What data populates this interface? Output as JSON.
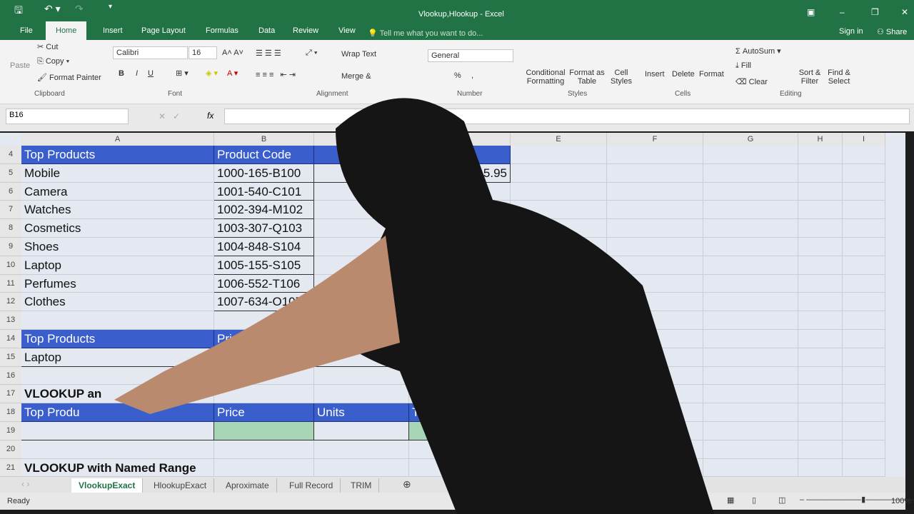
{
  "title": {
    "doc": "Vlookup,Hlookup - Excel",
    "sign_in": "Sign in",
    "share": "Share"
  },
  "tabs": [
    "File",
    "Home",
    "Insert",
    "Page Layout",
    "Formulas",
    "Data",
    "Review",
    "View"
  ],
  "tell_me": "Tell me what you want to do...",
  "ribbon": {
    "clipboard": {
      "paste": "Paste",
      "cut": "Cut",
      "copy": "Copy",
      "format_painter": "Format Painter",
      "label": "Clipboard"
    },
    "font": {
      "name": "Calibri",
      "size": "16",
      "label": "Font",
      "bold": "B",
      "italic": "I",
      "underline": "U"
    },
    "alignment": {
      "wrap": "Wrap Text",
      "merge": "Merge &",
      "label": "Alignment"
    },
    "number": {
      "format": "General",
      "percent": "%",
      "comma": ",",
      "label": "Number"
    },
    "styles": {
      "conditional": "Conditional Formatting",
      "format_table": "Format as Table",
      "cell_styles": "Cell Styles",
      "label": "Styles"
    },
    "cells": {
      "insert": "Insert",
      "delete": "Delete",
      "format": "Format",
      "label": "Cells"
    },
    "editing": {
      "autosum": "AutoSum",
      "fill": "Fill",
      "clear": "Clear",
      "sort": "Sort & Filter",
      "find": "Find & Select",
      "label": "Editing"
    }
  },
  "formula_bar": {
    "name_box": "B16",
    "fx": "fx",
    "value": ""
  },
  "columns": [
    "A",
    "B",
    "",
    "",
    "E",
    "F",
    "G",
    "H",
    "I"
  ],
  "rows": [
    {
      "n": "4",
      "cells": [
        {
          "c": 0,
          "t": "Top Products",
          "s": "hdr"
        },
        {
          "c": 1,
          "t": "Product Code",
          "s": "hdr"
        },
        {
          "c": 2,
          "t": "",
          "s": "hdr"
        },
        {
          "c": 3,
          "t": "",
          "s": "hdr"
        }
      ]
    },
    {
      "n": "5",
      "cells": [
        {
          "c": 0,
          "t": "Mobile"
        },
        {
          "c": 1,
          "t": "1000-165-B100",
          "s": "bd"
        },
        {
          "c": 2,
          "t": "",
          "s": "bd"
        },
        {
          "c": 3,
          "t": "5.95",
          "s": "bd r"
        }
      ]
    },
    {
      "n": "6",
      "cells": [
        {
          "c": 0,
          "t": "Camera"
        },
        {
          "c": 1,
          "t": "1001-540-C101",
          "s": "bd"
        }
      ]
    },
    {
      "n": "7",
      "cells": [
        {
          "c": 0,
          "t": "Watches"
        },
        {
          "c": 1,
          "t": "1002-394-M102",
          "s": "bd"
        }
      ]
    },
    {
      "n": "8",
      "cells": [
        {
          "c": 0,
          "t": "Cosmetics"
        },
        {
          "c": 1,
          "t": "1003-307-Q103",
          "s": "bd"
        }
      ]
    },
    {
      "n": "9",
      "cells": [
        {
          "c": 0,
          "t": "Shoes"
        },
        {
          "c": 1,
          "t": "1004-848-S104",
          "s": "bd"
        }
      ]
    },
    {
      "n": "10",
      "cells": [
        {
          "c": 0,
          "t": "Laptop"
        },
        {
          "c": 1,
          "t": "1005-155-S105",
          "s": "bd"
        }
      ]
    },
    {
      "n": "11",
      "cells": [
        {
          "c": 0,
          "t": "Perfumes"
        },
        {
          "c": 1,
          "t": "1006-552-T106",
          "s": "bd"
        }
      ]
    },
    {
      "n": "12",
      "cells": [
        {
          "c": 0,
          "t": "Clothes"
        },
        {
          "c": 1,
          "t": "1007-634-O107",
          "s": "bd"
        }
      ]
    },
    {
      "n": "13",
      "cells": []
    },
    {
      "n": "14",
      "cells": [
        {
          "c": 0,
          "t": "Top Products",
          "s": "hdr"
        },
        {
          "c": 1,
          "t": "Price",
          "s": "hdr"
        },
        {
          "c": 2,
          "t": "",
          "s": "hdr"
        },
        {
          "c": 3,
          "t": "To",
          "s": "hdr"
        }
      ]
    },
    {
      "n": "15",
      "cells": [
        {
          "c": 0,
          "t": "Laptop",
          "s": "bd"
        },
        {
          "c": 1,
          "t": "",
          "s": "bd green"
        },
        {
          "c": 2,
          "t": "",
          "s": "bd"
        },
        {
          "c": 3,
          "t": "",
          "s": "bd green"
        }
      ]
    },
    {
      "n": "16",
      "cells": [
        {
          "c": 3,
          "t": "",
          "s": "green"
        }
      ]
    },
    {
      "n": "17",
      "cells": [
        {
          "c": 0,
          "t": "VLOOKUP an",
          "s": "bold"
        }
      ]
    },
    {
      "n": "18",
      "cells": [
        {
          "c": 0,
          "t": "Top Produ",
          "s": "hdr"
        },
        {
          "c": 1,
          "t": "Price",
          "s": "hdr"
        },
        {
          "c": 2,
          "t": "Units",
          "s": "hdr"
        },
        {
          "c": 3,
          "t": "Total",
          "s": "hdr"
        }
      ]
    },
    {
      "n": "19",
      "cells": [
        {
          "c": 0,
          "t": "",
          "s": "bd"
        },
        {
          "c": 1,
          "t": "",
          "s": "bd green"
        },
        {
          "c": 2,
          "t": "",
          "s": "bd"
        },
        {
          "c": 3,
          "t": "",
          "s": "bd green"
        }
      ]
    },
    {
      "n": "20",
      "cells": []
    },
    {
      "n": "21",
      "cells": [
        {
          "c": 0,
          "t": "VLOOKUP with Named Range",
          "s": "bold"
        }
      ]
    }
  ],
  "sheet_tabs": [
    "VlookupExact",
    "HlookupExact",
    "Aproximate",
    "Full Record",
    "TRIM"
  ],
  "status": {
    "ready": "Ready",
    "zoom": "100%"
  },
  "colors": {
    "excel_green": "#217346",
    "header_blue": "#3a5fcd",
    "result_green": "#a8d5b5"
  }
}
